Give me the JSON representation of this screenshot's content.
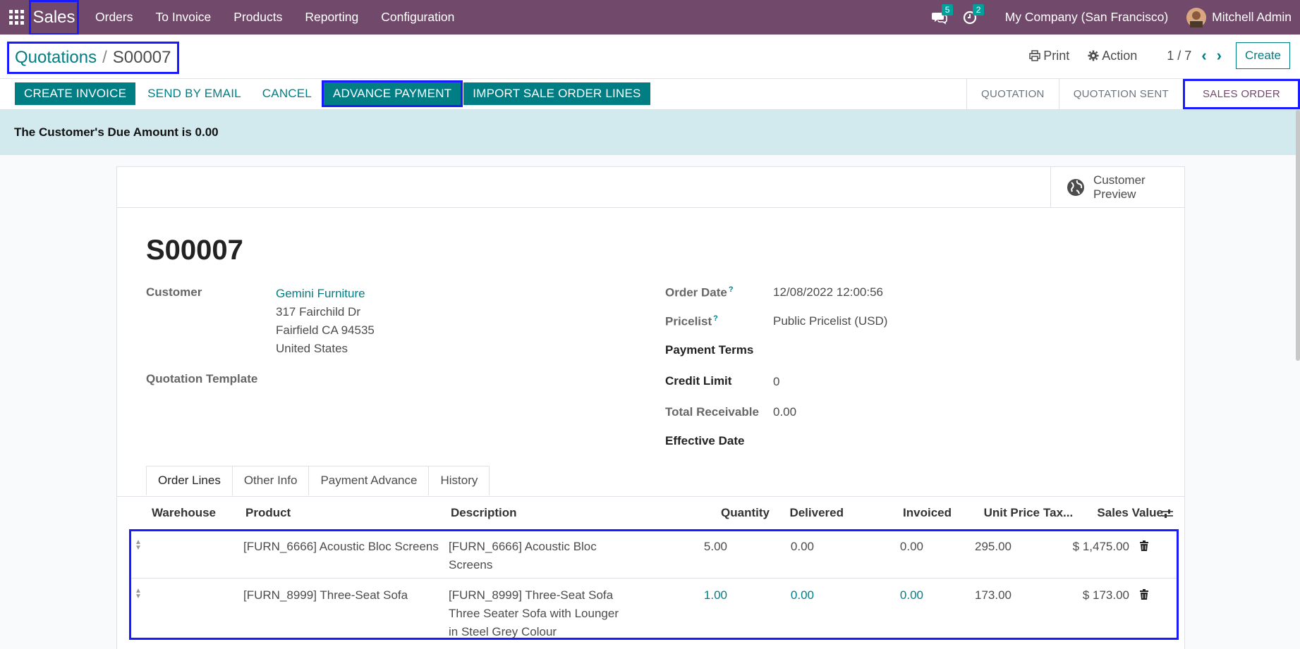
{
  "navbar": {
    "app_name": "Sales",
    "menu": [
      "Orders",
      "To Invoice",
      "Products",
      "Reporting",
      "Configuration"
    ],
    "messages_count": "5",
    "activities_count": "2",
    "company": "My Company (San Francisco)",
    "user": "Mitchell Admin"
  },
  "breadcrumb": {
    "parent": "Quotations",
    "separator": "/",
    "current": "S00007"
  },
  "control": {
    "print_label": "Print",
    "action_label": "Action",
    "pager": "1 / 7",
    "create_label": "Create"
  },
  "header_buttons": {
    "create_invoice": "CREATE INVOICE",
    "send_by_email": "SEND BY EMAIL",
    "cancel": "CANCEL",
    "advance_payment": "ADVANCE PAYMENT",
    "import_lines": "IMPORT SALE ORDER LINES"
  },
  "stages": [
    "QUOTATION",
    "QUOTATION SENT",
    "SALES ORDER"
  ],
  "alert": "The Customer's Due Amount is 0.00",
  "sheet": {
    "preview_line1": "Customer",
    "preview_line2": "Preview",
    "title": "S00007",
    "customer_label": "Customer",
    "customer_name": "Gemini Furniture",
    "address1": "317 Fairchild Dr",
    "address2": "Fairfield CA 94535",
    "address3": "United States",
    "quotation_template_label": "Quotation Template",
    "order_date_label": "Order Date",
    "order_date_value": "12/08/2022 12:00:56",
    "pricelist_label": "Pricelist",
    "pricelist_value": "Public Pricelist (USD)",
    "payment_terms_label": "Payment Terms",
    "credit_limit_label": "Credit Limit",
    "credit_limit_value": "0",
    "total_receivable_label": "Total Receivable",
    "total_receivable_value": "0.00",
    "effective_date_label": "Effective Date",
    "help_mark": "?"
  },
  "tabs": [
    "Order Lines",
    "Other Info",
    "Payment Advance",
    "History"
  ],
  "table": {
    "headers": {
      "warehouse": "Warehouse",
      "product": "Product",
      "description": "Description",
      "quantity": "Quantity",
      "delivered": "Delivered",
      "invoiced": "Invoiced",
      "unit_price": "Unit Price",
      "taxes": "Tax...",
      "sales_value": "Sales Value"
    },
    "rows": [
      {
        "product": "[FURN_6666] Acoustic Bloc Screens",
        "description_1": "[FURN_6666] Acoustic Bloc",
        "description_2": "Screens",
        "description_3": "",
        "quantity": "5.00",
        "delivered": "0.00",
        "invoiced": "0.00",
        "unit_price": "295.00",
        "sales_value": "$ 1,475.00"
      },
      {
        "product": "[FURN_8999] Three-Seat Sofa",
        "description_1": "[FURN_8999] Three-Seat Sofa",
        "description_2": "Three Seater Sofa with Lounger",
        "description_3": "in Steel Grey Colour",
        "quantity": "1.00",
        "delivered": "0.00",
        "invoiced": "0.00",
        "unit_price": "173.00",
        "sales_value": "$ 173.00"
      }
    ]
  },
  "colors": {
    "navbar": "#71496a",
    "primary": "#017e84",
    "alert": "#d2e9ee",
    "highlight": "#1a1aff"
  }
}
